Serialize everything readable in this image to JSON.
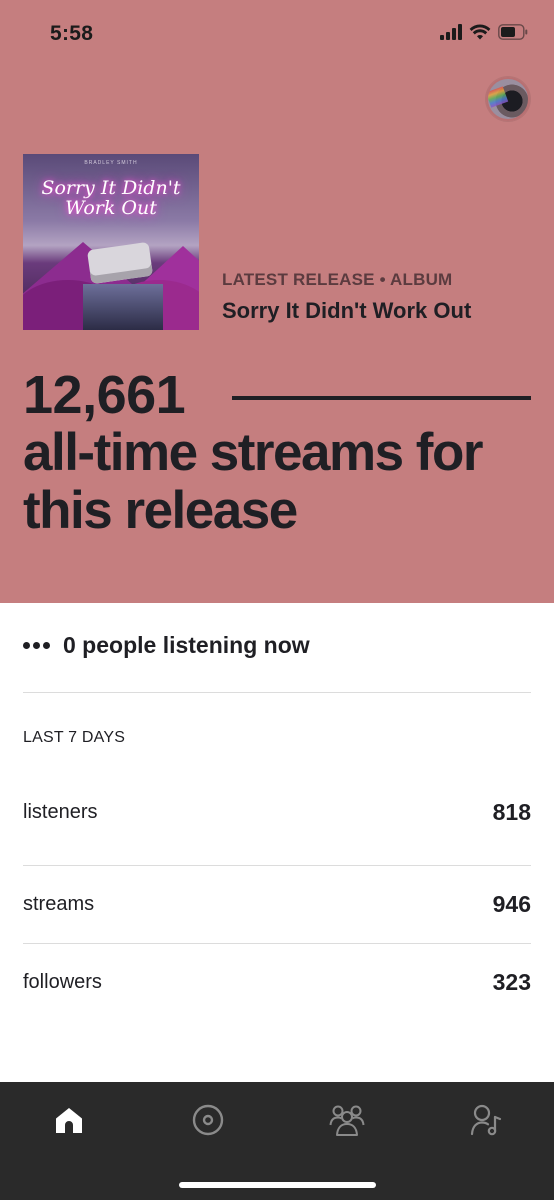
{
  "status_bar": {
    "time": "5:58"
  },
  "release": {
    "art_small_text": "BRADLEY SMITH",
    "art_title": "Sorry It Didn't Work Out",
    "kicker": "LATEST RELEASE • ALBUM",
    "title": "Sorry It Didn't Work Out"
  },
  "streams": {
    "count": "12,661",
    "caption": "all-time streams for this release"
  },
  "listening": {
    "text": "0 people listening now"
  },
  "period": {
    "label": "LAST 7 DAYS"
  },
  "stats": [
    {
      "label": "listeners",
      "value": "818"
    },
    {
      "label": "streams",
      "value": "946"
    },
    {
      "label": "followers",
      "value": "323"
    }
  ],
  "tabs": [
    {
      "icon": "home-icon",
      "active": true
    },
    {
      "icon": "music-disc-icon",
      "active": false
    },
    {
      "icon": "audience-icon",
      "active": false
    },
    {
      "icon": "profile-icon",
      "active": false
    }
  ],
  "colors": {
    "hero_bg": "#c57e7f",
    "tab_bar_bg": "#2a2a2a",
    "text": "#1f1f24",
    "tab_inactive": "#8a8a8a"
  }
}
